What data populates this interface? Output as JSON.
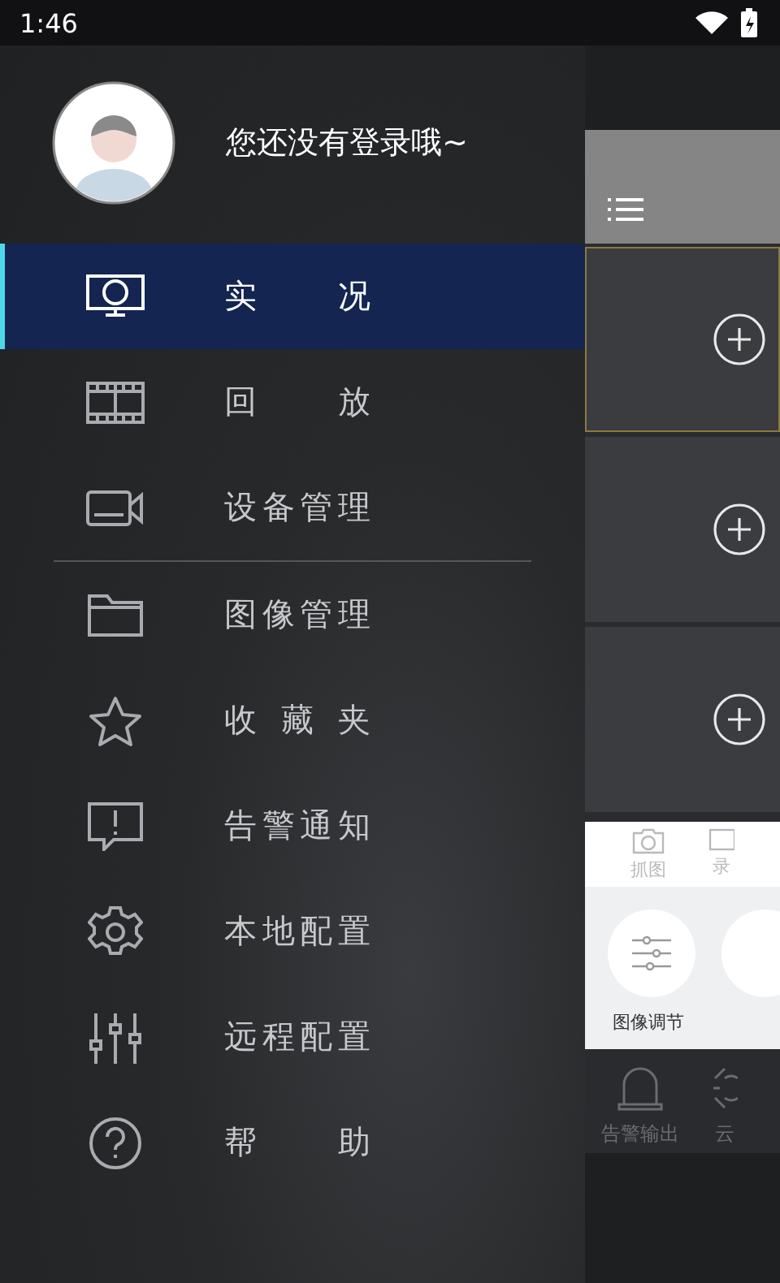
{
  "status_bar": {
    "time": "1:46"
  },
  "drawer": {
    "user_text": "您还没有登录哦~",
    "items": [
      {
        "kind": "item",
        "label": "实 况",
        "selected": true
      },
      {
        "kind": "item",
        "label": "回 放",
        "selected": false
      },
      {
        "kind": "item",
        "label": "设备管理",
        "selected": false
      },
      {
        "kind": "divider"
      },
      {
        "kind": "item",
        "label": "图像管理",
        "selected": false
      },
      {
        "kind": "item",
        "label": "收 藏 夹",
        "selected": false
      },
      {
        "kind": "item",
        "label": "告警通知",
        "selected": false
      },
      {
        "kind": "item",
        "label": "本地配置",
        "selected": false
      },
      {
        "kind": "item",
        "label": "远程配置",
        "selected": false
      },
      {
        "kind": "item",
        "label": "帮 助",
        "selected": false
      }
    ]
  },
  "background_screen": {
    "tiles": [
      {
        "selected": true
      },
      {
        "selected": false
      },
      {
        "selected": false
      }
    ],
    "toolbar": [
      {
        "label": "抓图"
      },
      {
        "label": "录"
      }
    ],
    "tools": [
      {
        "kind": "sliders",
        "label": "图像调节"
      },
      {
        "kind": "blank"
      }
    ],
    "bottom": [
      {
        "label": "告警输出"
      },
      {
        "label": "云"
      }
    ]
  }
}
